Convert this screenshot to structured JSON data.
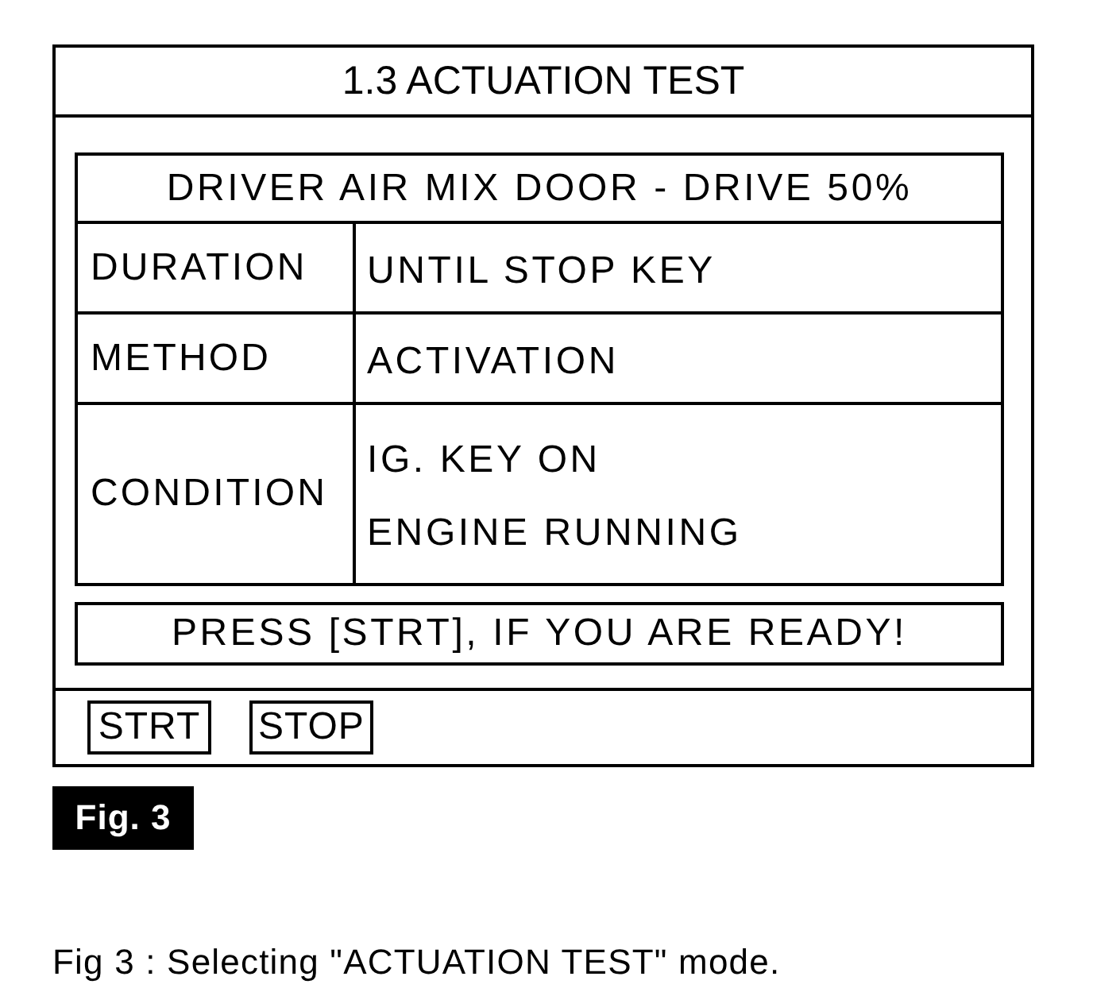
{
  "screen": {
    "title": "1.3 ACTUATION TEST",
    "test_table": {
      "header": "DRIVER AIR MIX DOOR - DRIVE 50%",
      "rows": [
        {
          "label": "DURATION",
          "values": [
            "UNTIL STOP KEY"
          ]
        },
        {
          "label": "METHOD",
          "values": [
            "ACTIVATION"
          ]
        },
        {
          "label": "CONDITION",
          "values": [
            "IG. KEY ON",
            "ENGINE RUNNING"
          ]
        }
      ]
    },
    "message": "PRESS [STRT], IF YOU ARE READY!",
    "buttons": [
      "STRT",
      "STOP"
    ]
  },
  "figure_label": "Fig. 3",
  "caption": "Fig 3 : Selecting \"ACTUATION TEST\" mode."
}
